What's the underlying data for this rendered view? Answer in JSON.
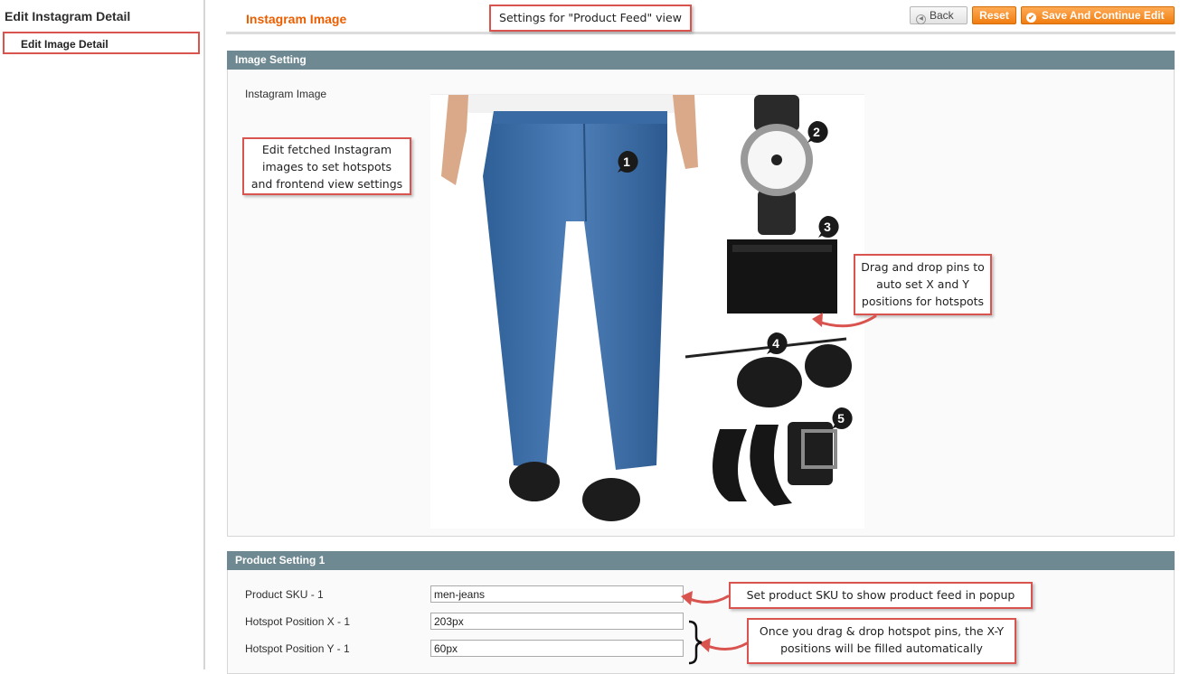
{
  "sidebar": {
    "title": "Edit Instagram Detail",
    "items": [
      {
        "label": "Edit Image Detail"
      }
    ]
  },
  "header": {
    "title": "Instagram Image",
    "buttons": {
      "back": "Back",
      "reset": "Reset",
      "save_continue": "Save And Continue Edit"
    }
  },
  "image_setting": {
    "heading": "Image Setting",
    "label": "Instagram Image",
    "pins": [
      "1",
      "2",
      "3",
      "4",
      "5"
    ]
  },
  "product_setting": {
    "heading": "Product Setting 1",
    "fields": [
      {
        "label": "Product SKU - 1",
        "value": "men-jeans"
      },
      {
        "label": "Hotspot Position X - 1",
        "value": "203px"
      },
      {
        "label": "Hotspot Position Y - 1",
        "value": "60px"
      }
    ]
  },
  "callouts": {
    "product_feed": "Settings for \"Product Feed\" view",
    "edit_images": [
      "Edit fetched Instagram",
      "images to set hotspots",
      "and frontend view settings"
    ],
    "drag_drop": [
      "Drag and drop pins to",
      "auto set X and Y",
      "positions for hotspots"
    ],
    "sku": "Set product SKU to show product feed in popup",
    "auto_fill": [
      "Once you drag & drop hotspot pins, the X-Y",
      "positions will be filled automatically"
    ]
  },
  "colors": {
    "accent": "#eb5e00",
    "section_header": "#6f8992",
    "callout_border": "#d9534f",
    "button_orange": "#f07d10"
  }
}
